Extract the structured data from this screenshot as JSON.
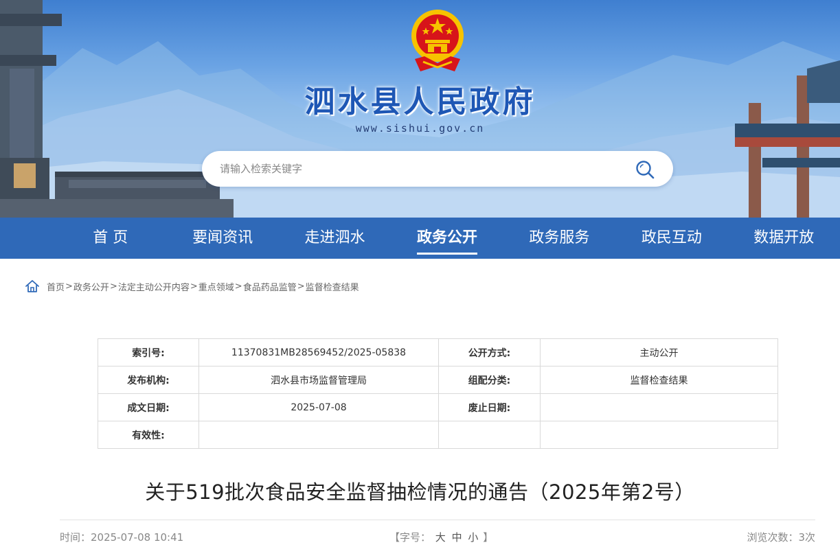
{
  "header": {
    "site_title": "泗水县人民政府",
    "site_url": "www.sishui.gov.cn",
    "search_placeholder": "请输入检索关键字"
  },
  "nav": {
    "items": [
      {
        "label": "首 页"
      },
      {
        "label": "要闻资讯"
      },
      {
        "label": "走进泗水"
      },
      {
        "label": "政务公开",
        "active": true
      },
      {
        "label": "政务服务"
      },
      {
        "label": "政民互动"
      },
      {
        "label": "数据开放"
      }
    ]
  },
  "breadcrumb": [
    "首页",
    "政务公开",
    "法定主动公开内容",
    "重点领域",
    "食品药品监管",
    "监督检查结果"
  ],
  "breadcrumb_separator": ">",
  "meta": {
    "index_no_label": "索引号:",
    "index_no": "11370831MB28569452/2025-05838",
    "disclosure_label": "公开方式:",
    "disclosure": "主动公开",
    "publisher_label": "发布机构:",
    "publisher": "泗水县市场监督管理局",
    "category_label": "组配分类:",
    "category": "监督检查结果",
    "created_label": "成文日期:",
    "created": "2025-07-08",
    "expiry_label": "废止日期:",
    "expiry": "",
    "validity_label": "有效性:",
    "validity": ""
  },
  "article": {
    "title": "关于519批次食品安全监督抽检情况的通告（2025年第2号）",
    "time": "时间：2025-07-08 10:41",
    "font_size_prefix": "【字号：",
    "font_large": "大",
    "font_medium": "中",
    "font_small": "小",
    "font_size_suffix": "】",
    "views": "浏览次数：3次"
  },
  "colors": {
    "nav_bg": "#2f69b8",
    "title_blue": "#1e57b5",
    "emblem_red": "#d7141a",
    "emblem_gold": "#f7c300"
  },
  "icons": {
    "search": "search-icon",
    "home": "home-icon",
    "emblem": "national-emblem-icon"
  }
}
